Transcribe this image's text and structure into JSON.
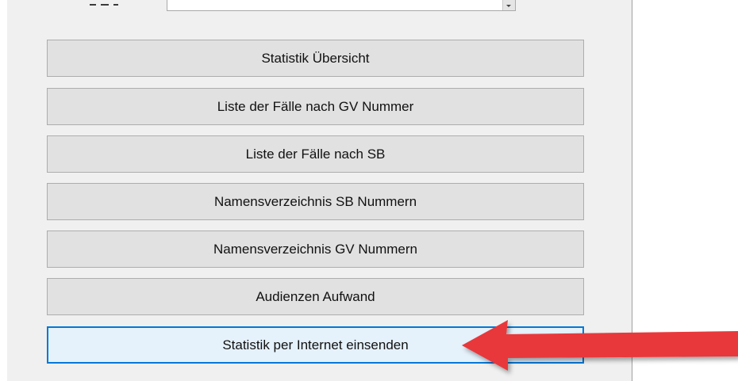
{
  "buttons": [
    {
      "label": "Statistik Übersicht"
    },
    {
      "label": "Liste der Fälle nach GV Nummer"
    },
    {
      "label": "Liste der Fälle nach SB"
    },
    {
      "label": "Namensverzeichnis SB Nummern"
    },
    {
      "label": "Namensverzeichnis GV Nummern"
    },
    {
      "label": "Audienzen Aufwand"
    },
    {
      "label": "Statistik per Internet einsenden"
    }
  ],
  "annotation": {
    "arrow_icon": "red-arrow-pointing-left",
    "arrow_color": "#e8373a"
  },
  "colors": {
    "focus_border": "#0078d7",
    "button_face": "#e1e1e1",
    "panel": "#f0f0f0"
  }
}
